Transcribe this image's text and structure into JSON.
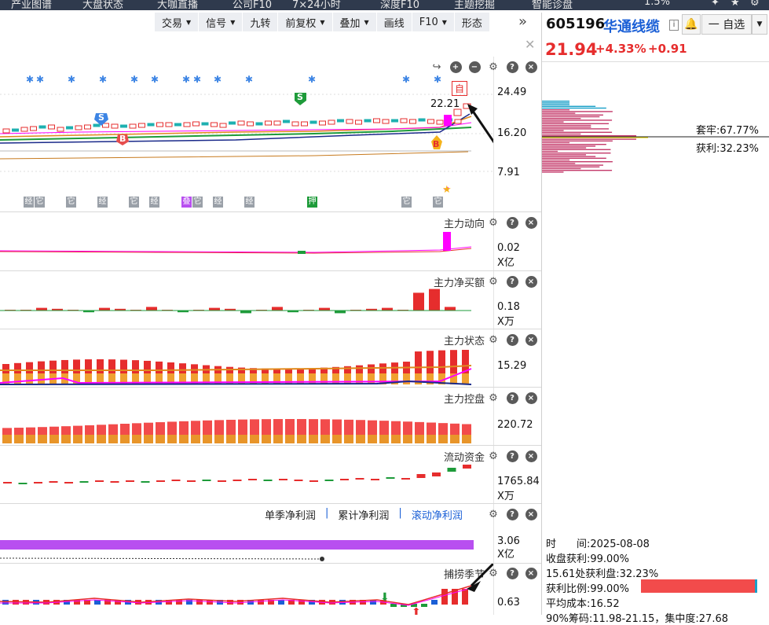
{
  "topnav": [
    "产业图谱",
    "大盘状态",
    "大咖直播",
    "公司F10",
    "7×24小时",
    "深度F10",
    "主题挖掘",
    "智能诊盘",
    "1.5%"
  ],
  "toolbar": [
    {
      "label": "交易",
      "dropdown": true
    },
    {
      "label": "信号",
      "dropdown": true
    },
    {
      "label": "九转",
      "dropdown": false
    },
    {
      "label": "前复权",
      "dropdown": true
    },
    {
      "label": "叠加",
      "dropdown": true
    },
    {
      "label": "画线",
      "dropdown": false
    },
    {
      "label": "F10",
      "dropdown": true
    },
    {
      "label": "形态",
      "dropdown": false
    }
  ],
  "more_icon": "double-chevron-right-icon",
  "main_chart": {
    "axis": [
      "24.49",
      "16.20",
      "7.91"
    ],
    "annotation": "22.21",
    "self_badge": "自",
    "markers": {
      "s1": "S",
      "b1": "B",
      "s2": "S",
      "b2": "B"
    },
    "event_tags": [
      "经",
      "它",
      "它",
      "经",
      "它",
      "经",
      "叠",
      "它",
      "经",
      "经",
      "押",
      "它",
      "它"
    ]
  },
  "panels": [
    {
      "title": "主力动向",
      "value": "0.02",
      "unit": "X亿"
    },
    {
      "title": "主力净买额",
      "value": "0.18",
      "unit": "X万"
    },
    {
      "title": "主力状态",
      "value": "15.29",
      "unit": ""
    },
    {
      "title": "主力控盘",
      "value": "220.72",
      "unit": ""
    },
    {
      "title": "流动资金",
      "value": "1765.84",
      "unit": "X万"
    }
  ],
  "profit_panel": {
    "tabs": [
      "单季净利润",
      "累计净利润",
      "滚动净利润"
    ],
    "separator": "|",
    "value": "3.06",
    "unit": "X亿"
  },
  "season_panel": {
    "title": "捕捞季节",
    "value": "0.63"
  },
  "stock": {
    "code": "605196",
    "name": "华通线缆",
    "price": "21.94",
    "pct": "+4.33%",
    "change": "+0.91",
    "watch_label": "一 自选",
    "info_badge": "i"
  },
  "chips": {
    "trapped": "套牢:67.77%",
    "profit": "获利:32.23%"
  },
  "stats": [
    "时　　间:2025-08-08",
    "收盘获利:99.00%",
    "15.61处获利盘:32.23%",
    "获利比例:99.00%",
    "平均成本:16.52",
    "90%筹码:11.98-21.15，集中度:27.68"
  ],
  "colors": {
    "up": "#e62d2d",
    "down": "#1e9b3a",
    "link": "#1a5fd6",
    "magenta": "#ff00ff",
    "orange": "#e08a1e",
    "purple": "#b84ff0"
  }
}
